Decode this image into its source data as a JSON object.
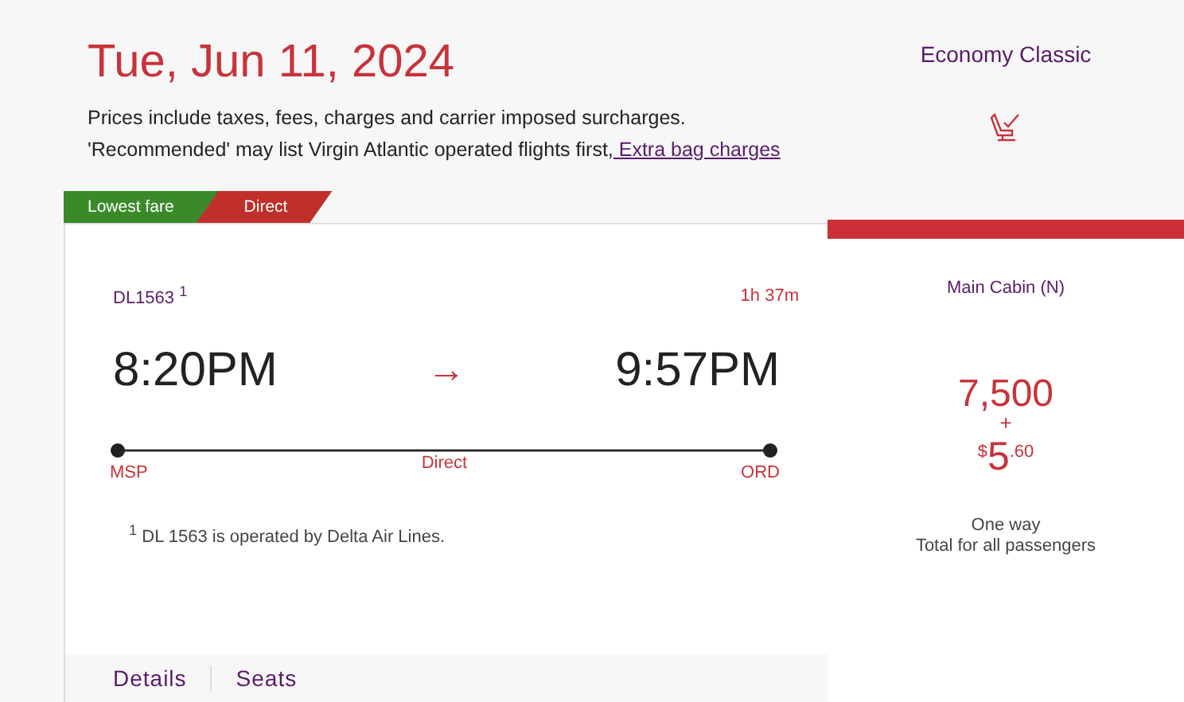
{
  "date": "Tue, Jun 11, 2024",
  "notice": {
    "text": "Prices include taxes, fees, charges and carrier imposed surcharges. 'Recommended' may list Virgin Atlantic operated flights first,",
    "link": " Extra bag charges"
  },
  "tags": [
    {
      "label": "Lowest fare",
      "color": "#3a8a2a"
    },
    {
      "label": "Direct",
      "color": "#c0302a"
    }
  ],
  "flight": {
    "number": "DL1563 $^{1}$",
    "duration": "1h 37m",
    "depart_time": "8:20PM",
    "arrow": "→",
    "arrive_time": "9:57PM",
    "origin": "MSP",
    "stops": "Direct",
    "destination": "ORD",
    "footnote": "$^{1}$ DL 1563 is operated by Delta Air Lines."
  },
  "links": [
    "Details",
    "Seats"
  ],
  "fare": {
    "cabin_class": "Economy Classic",
    "fare_name": "Main Cabin (N)",
    "points": "7,500",
    "plus": "+",
    "currency": "$",
    "dollars": "5",
    "cents": ".60",
    "trip": "One way",
    "total_note": "Total for all passengers"
  }
}
